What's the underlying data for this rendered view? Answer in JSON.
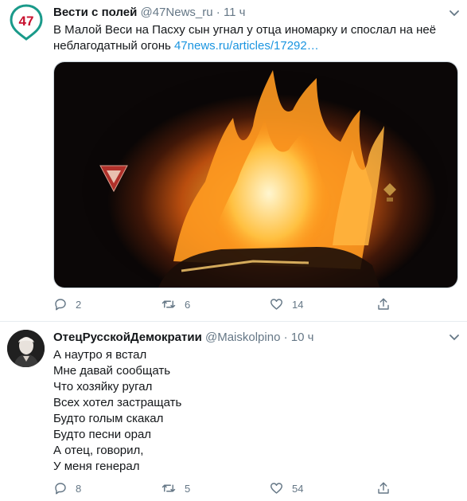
{
  "tweets": [
    {
      "author_name": "Вести с полей",
      "handle": "@47News_ru",
      "separator": "·",
      "time": "11 ч",
      "avatar_text": "47",
      "text": "В Малой Веси на Пасху сын угнал у отца иномарку и спослал на неё неблагодатный огонь",
      "link_text": "47news.ru/articles/17292…",
      "image_alt": "burning-car-photo",
      "actions": {
        "replies": "2",
        "retweets": "6",
        "likes": "14"
      }
    },
    {
      "author_name": "ОтецРусскойДемократии",
      "handle": "@Maiskolpino",
      "separator": "·",
      "time": "10 ч",
      "lines": [
        "А наутро я встал",
        "Мне давай сообщать",
        "Что хозяйку ругал",
        "Всех хотел застращать",
        "Будто голым скакал",
        "Будто песни орал",
        "А отец, говорил,",
        "У меня генерал"
      ],
      "actions": {
        "replies": "8",
        "retweets": "5",
        "likes": "54"
      }
    }
  ],
  "colors": {
    "accent_red": "#c8102e",
    "muted": "#657786",
    "link": "#1b95e0"
  }
}
